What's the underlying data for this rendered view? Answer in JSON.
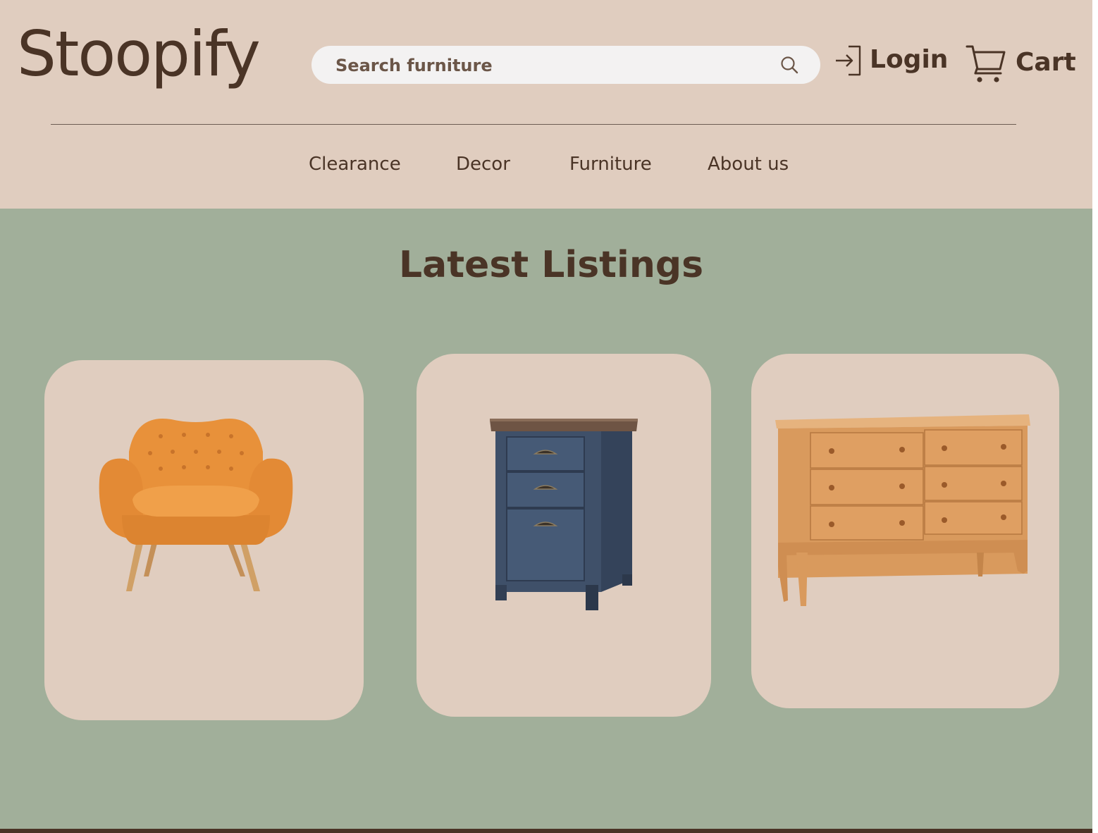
{
  "brand": {
    "name": "Stoopify"
  },
  "search": {
    "placeholder": "Search furniture",
    "value": "",
    "icon": "search-icon"
  },
  "actions": {
    "login_label": "Login",
    "login_icon": "login-arrow-icon",
    "cart_label": "Cart",
    "cart_icon": "shopping-cart-icon"
  },
  "nav": {
    "items": [
      {
        "label": "Clearance"
      },
      {
        "label": "Decor"
      },
      {
        "label": "Furniture"
      },
      {
        "label": "About us"
      }
    ]
  },
  "main": {
    "title": "Latest Listings",
    "listings": [
      {
        "item": "orange-tufted-armchair"
      },
      {
        "item": "navy-three-drawer-cabinet"
      },
      {
        "item": "wood-six-drawer-dresser"
      }
    ]
  },
  "colors": {
    "header_bg": "#e0cdbf",
    "main_bg": "#a1af9a",
    "text": "#4a3426",
    "search_bg": "#f3f2f2",
    "card_bg": "#e0cdbf"
  }
}
